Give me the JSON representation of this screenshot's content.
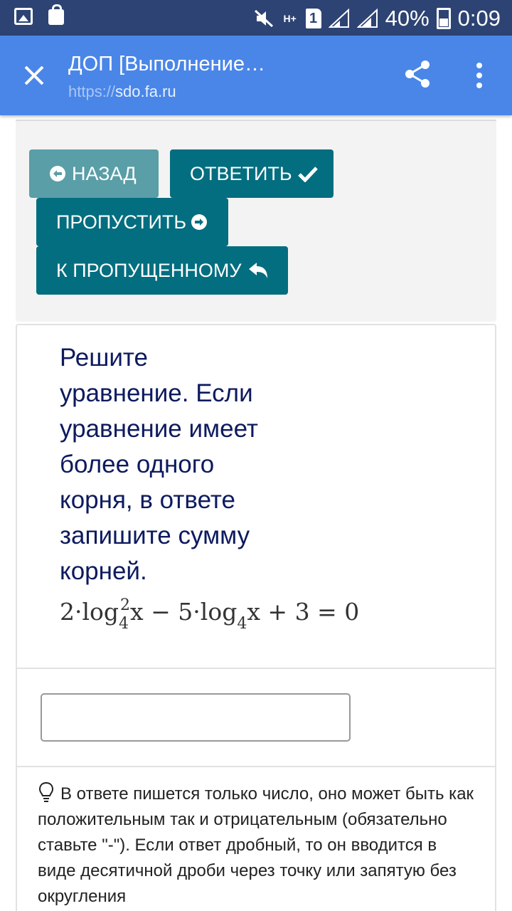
{
  "status_bar": {
    "battery": "40%",
    "time": "0:09",
    "sim": "1",
    "network": "H+"
  },
  "app_bar": {
    "title": "ДОП [Выполнение…",
    "url_protocol": "https://",
    "url_host": "sdo.fa.ru"
  },
  "buttons": {
    "back": "НАЗАД",
    "answer": "ОТВЕТИТЬ",
    "skip": "ПРОПУСТИТЬ",
    "to_skipped": "К ПРОПУЩЕННОМУ"
  },
  "question": {
    "text": "Решите уравнение. Если уравнение имеет более одного корня, в ответе запишите сумму корней.",
    "formula": {
      "coef1": "2·log",
      "base": "4",
      "power": "2",
      "rest1": "x − 5·log",
      "rest2": "x + 3 = 0"
    }
  },
  "answer_input": {
    "value": "",
    "placeholder": ""
  },
  "hint": {
    "text": "В ответе пишется только число, оно может быть как положительным так и отрицательным (обязательно ставьте \"-\"). Если ответ дробный, то он вводится в виде десятичной дроби через точку или запятую без округления"
  },
  "colors": {
    "status_bar": "#2d4373",
    "app_bar": "#4a86e8",
    "button_primary": "#036e80",
    "button_back": "#5a9ea7",
    "question_text": "#0d1a5e"
  },
  "icons": [
    "image-icon",
    "bag-icon",
    "mute-icon",
    "sim-icon",
    "signal-icon",
    "battery-icon",
    "close-icon",
    "share-icon",
    "more-vert-icon",
    "arrow-left-circle-icon",
    "check-icon",
    "arrow-right-circle-icon",
    "reply-icon",
    "lightbulb-icon"
  ]
}
